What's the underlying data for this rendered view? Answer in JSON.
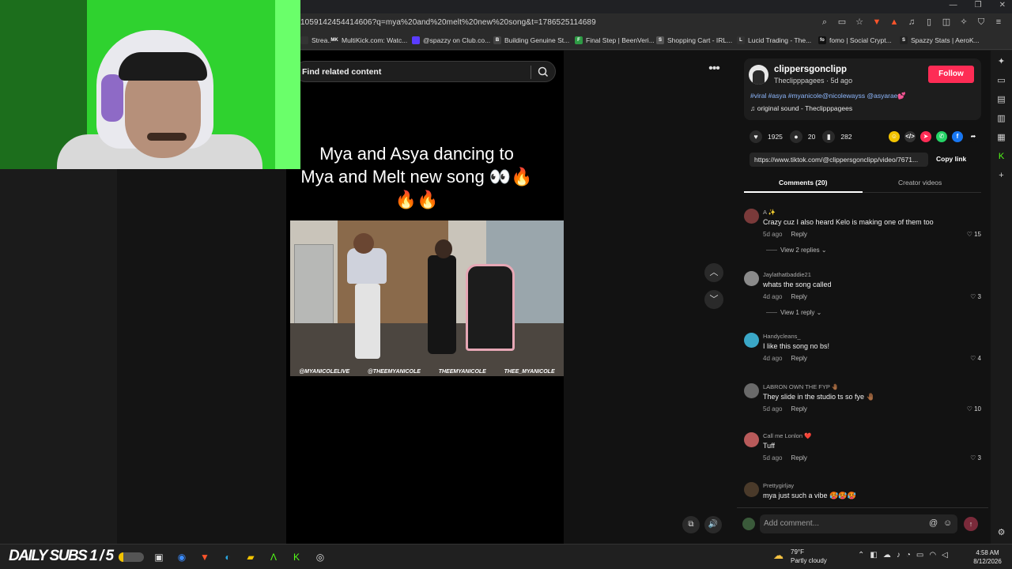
{
  "browser": {
    "url": "1059142454414606?q=mya%20and%20melt%20new%20song&t=1786525114689",
    "bookmarks": [
      {
        "label": "Strea...",
        "color": "#333333",
        "glyph": ""
      },
      {
        "label": "MultiKick.com: Watc...",
        "color": "#2b2b2b",
        "glyph": "MK"
      },
      {
        "label": "@spazzy on Club.co...",
        "color": "#5a3cff",
        "glyph": ""
      },
      {
        "label": "Building Genuine St...",
        "color": "#444444",
        "glyph": "B"
      },
      {
        "label": "Final Step | BeenVeri...",
        "color": "#2e9b45",
        "glyph": "F"
      },
      {
        "label": "Shopping Cart - IRL...",
        "color": "#555555",
        "glyph": "S"
      },
      {
        "label": "Lucid Trading - The...",
        "color": "#333333",
        "glyph": "L"
      },
      {
        "label": "fomo | Social Crypt...",
        "color": "#111111",
        "glyph": "fo"
      },
      {
        "label": "Spazzy Stats | AeroK...",
        "color": "#222222",
        "glyph": "S"
      }
    ]
  },
  "search": {
    "placeholder": "Find related content"
  },
  "video": {
    "title_line1": "Mya and Asya dancing to",
    "title_line2": "Mya and Melt new song 👀🔥",
    "title_line3": "🔥🔥",
    "handles": [
      "@MYANICOLELIVE",
      "@THEEMYANICOLE",
      "THEEMYANICOLE",
      "THEE_MYANICOLE"
    ]
  },
  "creator": {
    "username": "clippersgonclipp",
    "meta": "Theclipppagees · 5d ago",
    "follow_label": "Follow",
    "description": "#viral #asya #myanicole@nicolewayss @asyarae💕",
    "sound": "♫  original sound - Theclipppagees"
  },
  "stats": {
    "likes": "1925",
    "comments": "20",
    "saves": "282"
  },
  "share": {
    "link": "https://www.tiktok.com/@clippersgonclipp/video/7671...",
    "copy_label": "Copy link",
    "icons": [
      {
        "name": "collab-icon",
        "color": "#f2c300",
        "glyph": "☺"
      },
      {
        "name": "embed-icon",
        "color": "#333333",
        "glyph": "</>"
      },
      {
        "name": "send-icon",
        "color": "#fe2c55",
        "glyph": "➤"
      },
      {
        "name": "whatsapp-icon",
        "color": "#25d366",
        "glyph": "✆"
      },
      {
        "name": "facebook-icon",
        "color": "#1877f2",
        "glyph": "f"
      },
      {
        "name": "share-arrow-icon",
        "color": "#121212",
        "glyph": "➦"
      }
    ]
  },
  "tabs": {
    "comments": "Comments (20)",
    "creator": "Creator videos"
  },
  "comments": [
    {
      "user": "A ✨",
      "text": "Crazy cuz I also heard Kelo is making one of them too",
      "age": "5d ago",
      "reply": "Reply",
      "likes": "15",
      "view": "View 2 replies",
      "avatar_color": "#7a3a3a"
    },
    {
      "user": "Jaylathatbaddie21",
      "text": "whats the song called",
      "age": "4d ago",
      "reply": "Reply",
      "likes": "3",
      "view": "View 1 reply",
      "avatar_color": "#8a8a8a"
    },
    {
      "user": "Handycleans_",
      "text": "I like this song no bs!",
      "age": "4d ago",
      "reply": "Reply",
      "likes": "4",
      "view": "",
      "avatar_color": "#3aa7c7"
    },
    {
      "user": "LABRON OWN THE FYP 🤚🏾",
      "text": "They slide in the studio ts so fye 🤚🏾",
      "age": "5d ago",
      "reply": "Reply",
      "likes": "10",
      "view": "",
      "avatar_color": "#6a6a6a"
    },
    {
      "user": "Call me Lonlon ❤️",
      "text": "Tuff",
      "age": "5d ago",
      "reply": "Reply",
      "likes": "3",
      "view": "",
      "avatar_color": "#b85a5a"
    },
    {
      "user": "Prettygirljay",
      "text": "mya just such a vibe 🥵🥵🥵",
      "age": "",
      "reply": "",
      "likes": "",
      "view": "",
      "avatar_color": "#4a3a2a"
    }
  ],
  "add_comment": {
    "placeholder": "Add comment..."
  },
  "taskbar": {
    "label": "DAILY SUBS 1 / 5",
    "goal_fraction": 0.2,
    "weather_temp": "79°F",
    "weather_desc": "Partly cloudy",
    "time": "4:58 AM",
    "date": "8/12/2026"
  },
  "colors": {
    "accent": "#fe2c55",
    "webcam_green": "#2fd22f"
  }
}
